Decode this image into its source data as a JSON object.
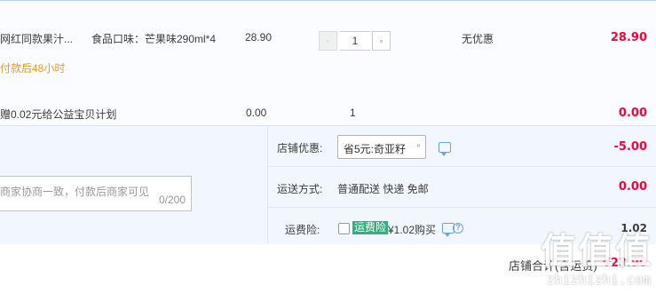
{
  "item": {
    "name": "网红同款果汁...",
    "sku": "食品口味：芒果味290ml*4",
    "price": "28.90",
    "quantity": "1",
    "promotion": "无优惠",
    "subtotal": "28.90",
    "delivery_note": "付款后48小时"
  },
  "charity": {
    "text": "赠0.02元给公益宝贝计划",
    "price": "0.00",
    "quantity": "1",
    "subtotal": "0.00"
  },
  "order": {
    "memo_placeholder": "商家协商一致，付款后商家可见",
    "memo_count": "0/200",
    "shop_discount_label": "店铺优惠:",
    "shop_discount_option": "省5元:奇亚籽",
    "shop_discount_value": "-5.00",
    "shipping_label": "运送方式:",
    "shipping_value": "普通配送 快递 免邮",
    "shipping_price": "0.00",
    "insurance_label": "运费险:",
    "insurance_badge": "运费险",
    "insurance_price_text": "¥1.02购买",
    "insurance_amount": "1.02"
  },
  "footer": {
    "total_label": "店铺合计(含运费)",
    "total_value": "¥23.90"
  },
  "watermark": {
    "main": "值值值",
    "sub": "zhizhizhi.com"
  },
  "colors": {
    "accent_red": "#ff0036",
    "link_blue": "#6aa6e6",
    "insurance_green": "#2bb37c",
    "delivery_orange": "#f09a1b"
  }
}
